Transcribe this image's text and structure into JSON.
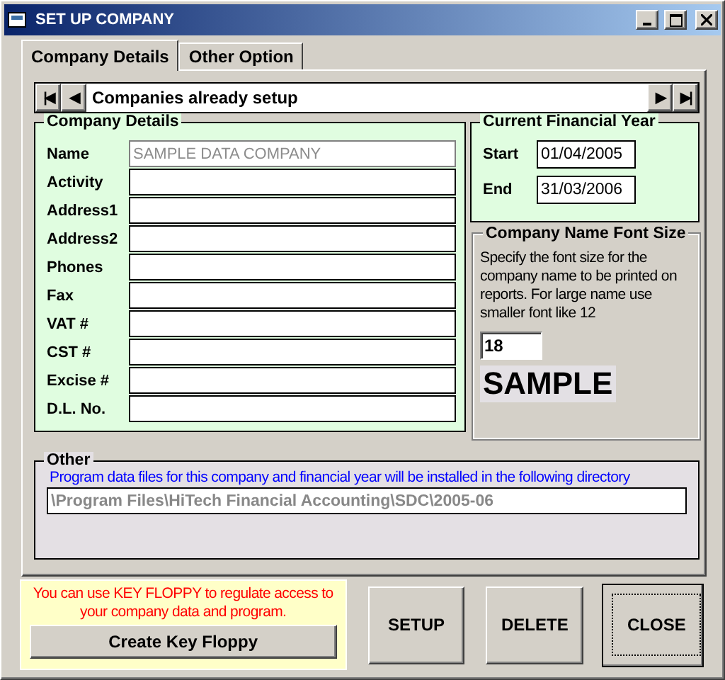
{
  "window": {
    "title": "SET UP COMPANY"
  },
  "tabs": [
    {
      "label": "Company Details",
      "selected": true
    },
    {
      "label": "Other Option",
      "selected": false
    }
  ],
  "navigator": {
    "first": "|◀",
    "prev": "◀",
    "caption": "Companies already setup",
    "next": "▶",
    "last": "▶|"
  },
  "company_details": {
    "title": "Company Details",
    "fields": [
      {
        "label": "Name",
        "value": "SAMPLE DATA COMPANY",
        "disabled": true
      },
      {
        "label": "Activity",
        "disabled": false
      },
      {
        "label": "Address1",
        "disabled": false
      },
      {
        "label": "Address2",
        "disabled": false
      },
      {
        "label": "Phones",
        "disabled": false
      },
      {
        "label": "Fax",
        "disabled": false
      },
      {
        "label": "VAT #",
        "disabled": false
      },
      {
        "label": "CST #",
        "disabled": false
      },
      {
        "label": "Excise #",
        "disabled": false
      },
      {
        "label": "D.L. No.",
        "disabled": false
      }
    ]
  },
  "financial_year": {
    "title": "Current Financial Year",
    "start_label": "Start",
    "start": "01/04/2005",
    "end_label": "End",
    "end": "31/03/2006"
  },
  "font_size": {
    "title": "Company Name Font Size",
    "description": "Specify the font size for the company name to be printed on reports. For large name use smaller font like 12",
    "value": "18",
    "sample": "SAMPLE"
  },
  "other": {
    "title": "Other",
    "note": "Program data files for this company and financial year will be installed in the following directory",
    "directory": "\\Program Files\\HiTech Financial Accounting\\SDC\\2005-06"
  },
  "key_floppy": {
    "note": "You can use KEY FLOPPY to regulate access to your company data and program.",
    "button": "Create Key Floppy"
  },
  "buttons": [
    {
      "label": "SETUP",
      "default": false
    },
    {
      "label": "DELETE",
      "default": false
    },
    {
      "label": "CLOSE",
      "default": true
    }
  ]
}
